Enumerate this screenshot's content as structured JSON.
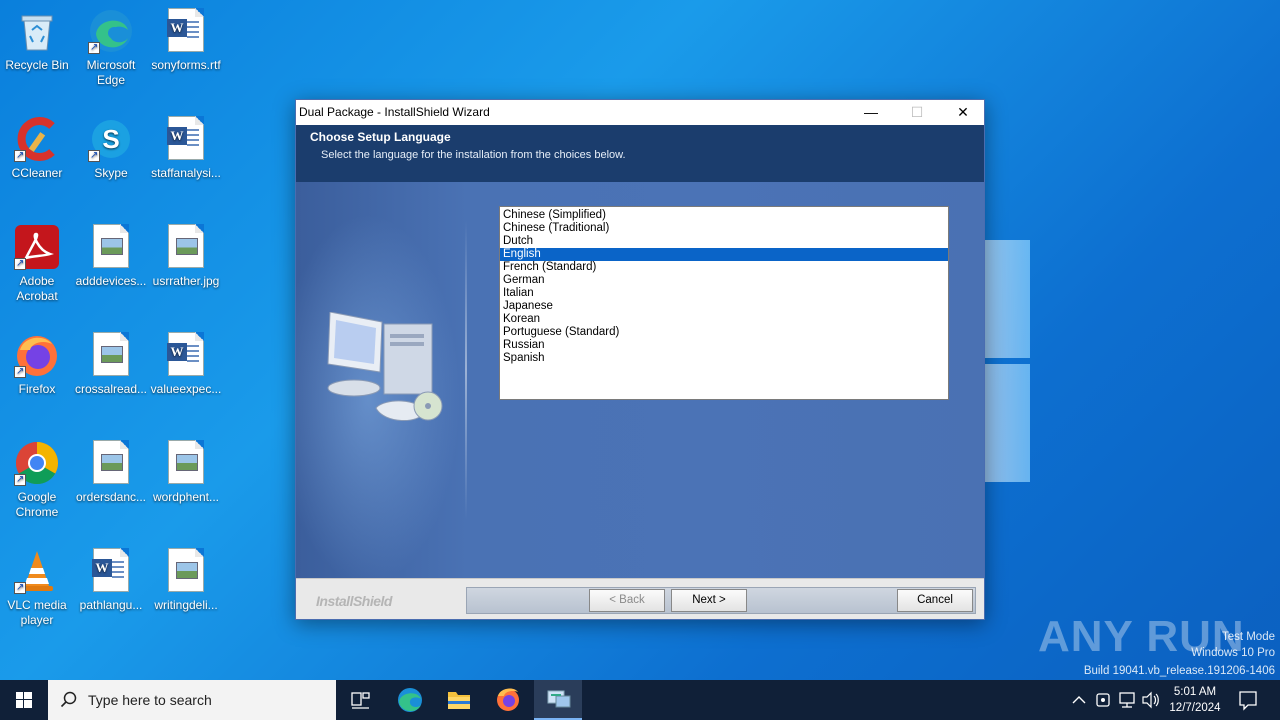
{
  "desktop": {
    "icons": [
      {
        "label": "Recycle Bin"
      },
      {
        "label": "Microsoft Edge"
      },
      {
        "label": "sonyforms.rtf"
      },
      {
        "label": "CCleaner"
      },
      {
        "label": "Skype"
      },
      {
        "label": "staffanalysi..."
      },
      {
        "label": "Adobe Acrobat"
      },
      {
        "label": "adddevices..."
      },
      {
        "label": "usrrather.jpg"
      },
      {
        "label": "Firefox"
      },
      {
        "label": "crossalread..."
      },
      {
        "label": "valueexpec..."
      },
      {
        "label": "Google Chrome"
      },
      {
        "label": "ordersdanc..."
      },
      {
        "label": "wordphent..."
      },
      {
        "label": "VLC media player"
      },
      {
        "label": "pathlangu..."
      },
      {
        "label": "writingdeli..."
      }
    ]
  },
  "window": {
    "title": "Dual Package - InstallShield Wizard",
    "minimize_glyph": "—",
    "maximize_glyph": "☐",
    "close_glyph": "✕",
    "heading": "Choose Setup Language",
    "subheading": "Select the language for the installation from the choices below.",
    "languages": [
      "Chinese (Simplified)",
      "Chinese (Traditional)",
      "Dutch",
      "English",
      "French (Standard)",
      "German",
      "Italian",
      "Japanese",
      "Korean",
      "Portuguese (Standard)",
      "Russian",
      "Spanish"
    ],
    "selected_language": "English",
    "brand": "InstallShield",
    "back_label": "< Back",
    "next_label": "Next >",
    "cancel_label": "Cancel"
  },
  "taskbar": {
    "search_placeholder": "Type here to search",
    "time": "5:01 AM",
    "date": "12/7/2024",
    "apps": [
      "task-view",
      "microsoft-edge",
      "file-explorer",
      "firefox",
      "installshield-wizard"
    ]
  },
  "watermark": {
    "line1": "Test Mode",
    "line2": "Windows 10 Pro",
    "line3": "Build 19041.vb_release.191206-1406",
    "logo_text": "ANY RUN"
  },
  "colors": {
    "banner": "#1b3d6d",
    "selection": "#0a64c8",
    "taskbar": "#102038"
  }
}
